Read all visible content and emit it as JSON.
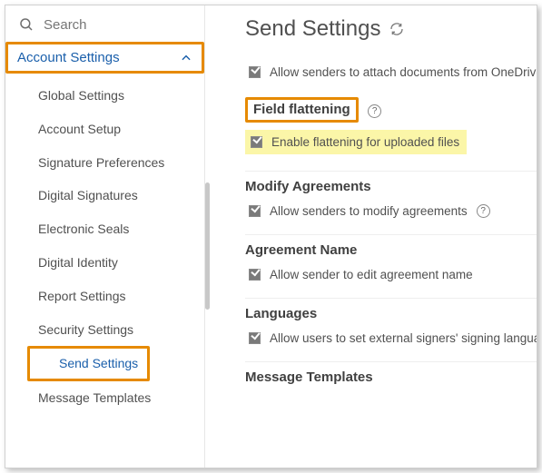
{
  "search": {
    "placeholder": "Search"
  },
  "sidebar": {
    "section": "Account Settings",
    "items": [
      {
        "label": "Global Settings"
      },
      {
        "label": "Account Setup"
      },
      {
        "label": "Signature Preferences"
      },
      {
        "label": "Digital Signatures"
      },
      {
        "label": "Electronic Seals"
      },
      {
        "label": "Digital Identity"
      },
      {
        "label": "Report Settings"
      },
      {
        "label": "Security Settings"
      },
      {
        "label": "Send Settings",
        "active": true
      },
      {
        "label": "Message Templates"
      }
    ]
  },
  "page": {
    "title": "Send Settings"
  },
  "top_setting": {
    "label": "Allow senders to attach documents from OneDrive"
  },
  "sections": {
    "field_flattening": {
      "heading": "Field flattening",
      "setting": "Enable flattening for uploaded files"
    },
    "modify_agreements": {
      "heading": "Modify Agreements",
      "setting": "Allow senders to modify agreements"
    },
    "agreement_name": {
      "heading": "Agreement Name",
      "setting": "Allow sender to edit agreement name"
    },
    "languages": {
      "heading": "Languages",
      "setting": "Allow users to set external signers' signing language"
    },
    "message_templates": {
      "heading": "Message Templates"
    }
  }
}
